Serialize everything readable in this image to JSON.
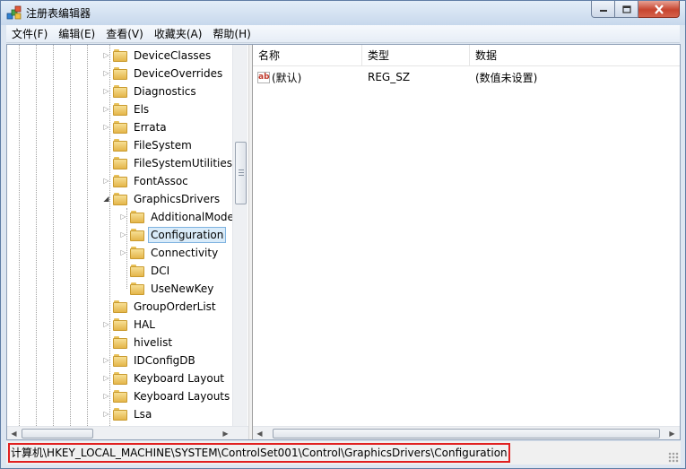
{
  "window": {
    "title": "注册表编辑器",
    "minimize_icon": "minimize-icon",
    "maximize_icon": "maximize-icon",
    "close_icon": "close-icon"
  },
  "menu": [
    {
      "label": "文件(F)"
    },
    {
      "label": "编辑(E)"
    },
    {
      "label": "查看(V)"
    },
    {
      "label": "收藏夹(A)"
    },
    {
      "label": "帮助(H)"
    }
  ],
  "tree": {
    "items": [
      {
        "label": "DeviceClasses",
        "expander": "▷"
      },
      {
        "label": "DeviceOverrides",
        "expander": "▷"
      },
      {
        "label": "Diagnostics",
        "expander": "▷"
      },
      {
        "label": "Els",
        "expander": "▷"
      },
      {
        "label": "Errata",
        "expander": "▷"
      },
      {
        "label": "FileSystem",
        "expander": ""
      },
      {
        "label": "FileSystemUtilities",
        "expander": ""
      },
      {
        "label": "FontAssoc",
        "expander": "▷"
      },
      {
        "label": "GraphicsDrivers",
        "expander": "◢"
      },
      {
        "label": "AdditionalMode",
        "expander": "▷"
      },
      {
        "label": "Configuration",
        "expander": "▷",
        "selected": true
      },
      {
        "label": "Connectivity",
        "expander": "▷"
      },
      {
        "label": "DCI",
        "expander": ""
      },
      {
        "label": "UseNewKey",
        "expander": ""
      },
      {
        "label": "GroupOrderList",
        "expander": ""
      },
      {
        "label": "HAL",
        "expander": "▷"
      },
      {
        "label": "hivelist",
        "expander": ""
      },
      {
        "label": "IDConfigDB",
        "expander": "▷"
      },
      {
        "label": "Keyboard Layout",
        "expander": "▷"
      },
      {
        "label": "Keyboard Layouts",
        "expander": "▷"
      },
      {
        "label": "Lsa",
        "expander": "▷"
      }
    ]
  },
  "list": {
    "columns": [
      {
        "label": "名称"
      },
      {
        "label": "类型"
      },
      {
        "label": "数据"
      }
    ],
    "rows": [
      {
        "icon": "string-value-icon",
        "icon_text": "ab",
        "name": "(默认)",
        "type": "REG_SZ",
        "data": "(数值未设置)"
      }
    ]
  },
  "status": {
    "path": "计算机\\HKEY_LOCAL_MACHINE\\SYSTEM\\ControlSet001\\Control\\GraphicsDrivers\\Configuration"
  },
  "colors": {
    "highlight_border": "#e02020",
    "selection_bg": "#d9ebf9",
    "folder": "#e4b64a"
  }
}
